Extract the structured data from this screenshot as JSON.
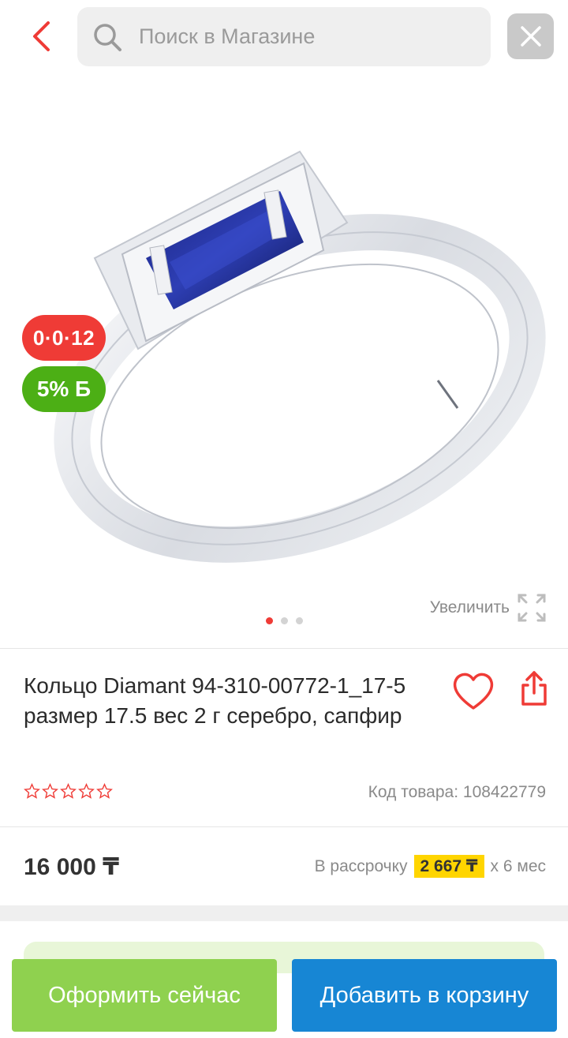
{
  "header": {
    "back_icon": "chevron-left-icon",
    "search_placeholder": "Поиск в Магазине",
    "close_icon": "close-icon"
  },
  "gallery": {
    "badge_installment": "0·0·12",
    "badge_bonus": "5% Б",
    "zoom_label": "Увеличить",
    "zoom_icon": "expand-icon",
    "image_count": 3,
    "active_image_index": 0
  },
  "product": {
    "title": "Кольцо Diamant 94-310-00772-1_17-5 размер 17.5 вес 2 г серебро, сапфир",
    "rating": 0,
    "rating_max": 5,
    "sku_label": "Код товара: 108422779"
  },
  "pricing": {
    "price": "16 000 ₸",
    "installment_prefix": "В рассрочку",
    "installment_amount": "2 667 ₸",
    "installment_suffix": "x 6 мес"
  },
  "actions": {
    "buy_now_label": "Оформить сейчас",
    "add_to_cart_label": "Добавить в корзину"
  },
  "colors": {
    "accent_red": "#ef3b36",
    "bonus_green": "#4caf15",
    "buy_green": "#8fd14f",
    "cart_blue": "#1786d4",
    "installment_yellow": "#ffd500"
  }
}
